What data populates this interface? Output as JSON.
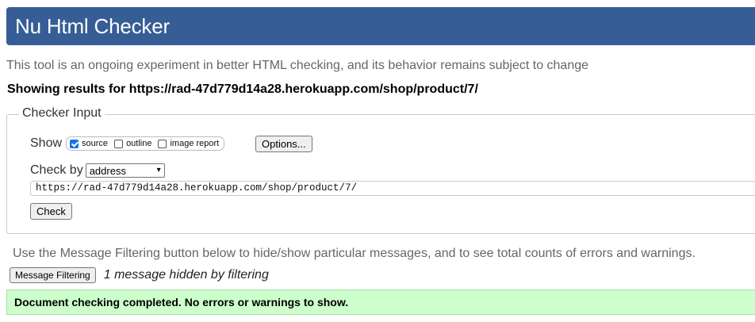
{
  "header": {
    "title": "Nu Html Checker"
  },
  "intro": "This tool is an ongoing experiment in better HTML checking, and its behavior remains subject to change",
  "results_for": "Showing results for https://rad-47d779d14a28.herokuapp.com/shop/product/7/",
  "checker_input": {
    "legend": "Checker Input",
    "show_label": "Show",
    "options": [
      {
        "label": "source",
        "checked": true
      },
      {
        "label": "outline",
        "checked": false
      },
      {
        "label": "image report",
        "checked": false
      }
    ],
    "options_button": "Options...",
    "check_by_label": "Check by",
    "check_by_value": "address",
    "url_value": "https://rad-47d779d14a28.herokuapp.com/shop/product/7/",
    "check_button": "Check"
  },
  "filtering": {
    "note": "Use the Message Filtering button below to hide/show particular messages, and to see total counts of errors and warnings.",
    "button": "Message Filtering",
    "hidden_message": "1 message hidden by filtering"
  },
  "status": {
    "message": "Document checking completed. No errors or warnings to show."
  },
  "colors": {
    "header_bg": "#365d95",
    "success_bg": "#ccffcc",
    "checkbox_accent": "#1a73e8"
  }
}
